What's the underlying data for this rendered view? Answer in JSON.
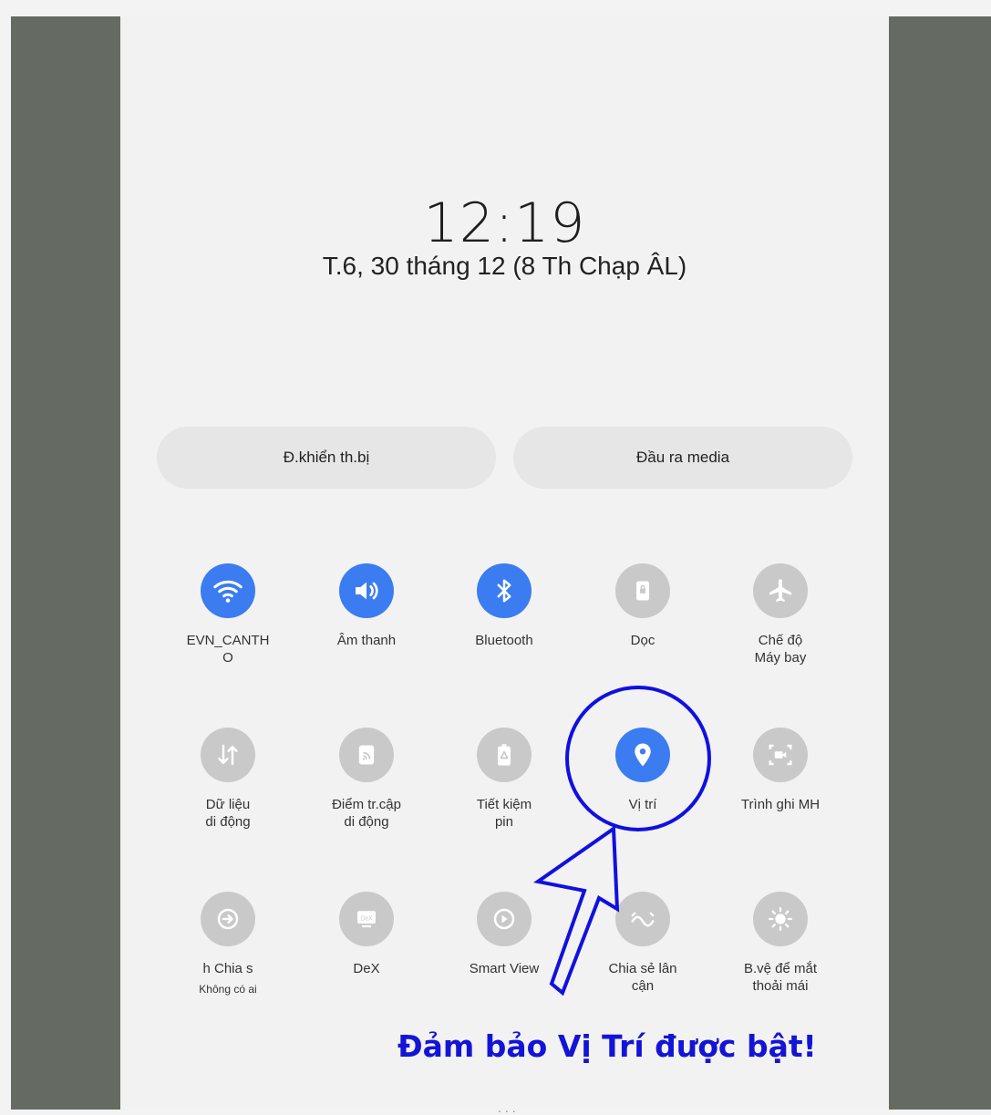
{
  "lockscreen": {
    "time": "12:19",
    "date": "T.6, 30 tháng 12 (8 Th Chạp ÂL)"
  },
  "quick_buttons": {
    "device_control": "Đ.khiển th.bị",
    "media_output": "Đầu ra media"
  },
  "tiles": {
    "wifi": {
      "label": "EVN_CANTH\nO",
      "active": true,
      "icon": "wifi-icon"
    },
    "sound": {
      "label": "Âm thanh",
      "active": true,
      "icon": "speaker-icon"
    },
    "bluetooth": {
      "label": "Bluetooth",
      "active": true,
      "icon": "bluetooth-icon"
    },
    "portrait": {
      "label": "Dọc",
      "active": false,
      "icon": "rotation-lock-icon"
    },
    "airplane": {
      "label": "Chế độ\nMáy bay",
      "active": false,
      "icon": "airplane-icon"
    },
    "mobile_data": {
      "label": "Dữ liệu\ndi động",
      "active": false,
      "icon": "data-arrows-icon"
    },
    "hotspot": {
      "label": "Điểm tr.cập\ndi động",
      "active": false,
      "icon": "hotspot-icon"
    },
    "power_saving": {
      "label": "Tiết kiệm\npin",
      "active": false,
      "icon": "battery-icon"
    },
    "location": {
      "label": "Vị trí",
      "active": true,
      "icon": "location-pin-icon"
    },
    "screen_recorder": {
      "label": "Trình ghi MH",
      "active": false,
      "icon": "screen-record-icon"
    },
    "quick_share": {
      "label": "h      Chia s",
      "sublabel": "Không có ai",
      "active": false,
      "icon": "share-icon"
    },
    "dex": {
      "label": "DeX",
      "active": false,
      "icon": "dex-icon"
    },
    "smart_view": {
      "label": "Smart View",
      "active": false,
      "icon": "smart-view-icon"
    },
    "nearby_share": {
      "label": "Chia sẻ lân\ncận",
      "active": false,
      "icon": "nearby-share-icon"
    },
    "eye_comfort": {
      "label": "B.vệ để mắt\nthoải mái",
      "active": false,
      "icon": "eye-comfort-icon"
    }
  },
  "annotation": {
    "text": "Đảm bảo Vị Trí được bật!",
    "color": "#1414d6"
  },
  "colors": {
    "active": "#3b7cf1",
    "inactive": "#c9c9c9",
    "frame": "#656a63"
  },
  "handle": "..."
}
